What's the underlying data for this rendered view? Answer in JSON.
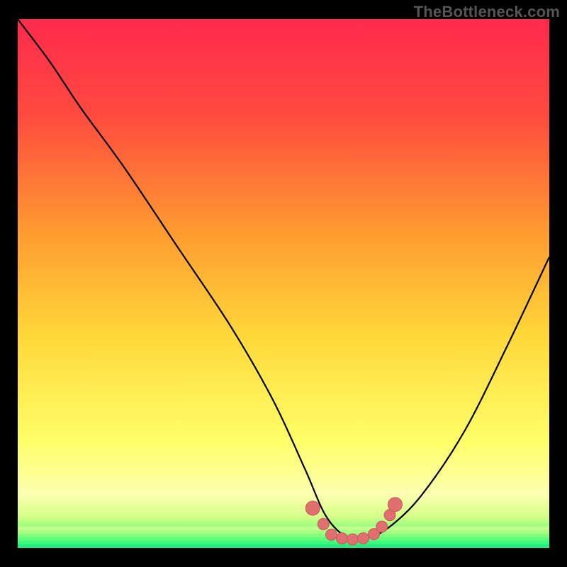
{
  "watermark": "TheBottleneck.com",
  "colors": {
    "bg": "#000000",
    "grad_top": "#ff2a4d",
    "grad_mid_upper": "#ff7a3a",
    "grad_mid": "#ffd63a",
    "grad_lower": "#fffb7a",
    "grad_green1": "#b6ff6a",
    "grad_green2": "#2eff8a",
    "curve": "#000000",
    "marker_fill": "#e07070",
    "marker_stroke": "#c85858"
  },
  "chart_data": {
    "type": "line",
    "title": "",
    "xlabel": "",
    "ylabel": "",
    "ylim": [
      0,
      100
    ],
    "xlim": [
      0,
      100
    ],
    "series": [
      {
        "name": "bottleneck-curve",
        "x": [
          0,
          6,
          12,
          20,
          30,
          40,
          48,
          54,
          58,
          62,
          66,
          70,
          76,
          84,
          92,
          100
        ],
        "y": [
          100,
          92,
          83,
          72,
          57,
          42,
          28,
          15,
          6,
          2,
          2,
          4,
          10,
          22,
          38,
          55
        ]
      }
    ],
    "markers": {
      "name": "highlight-dots",
      "x": [
        55.5,
        57.5,
        59,
        61,
        63,
        65,
        67,
        68.5,
        70,
        71
      ],
      "y": [
        7.5,
        4.5,
        2.5,
        1.8,
        1.6,
        1.8,
        2.6,
        4.0,
        6.2,
        8.2
      ]
    }
  }
}
